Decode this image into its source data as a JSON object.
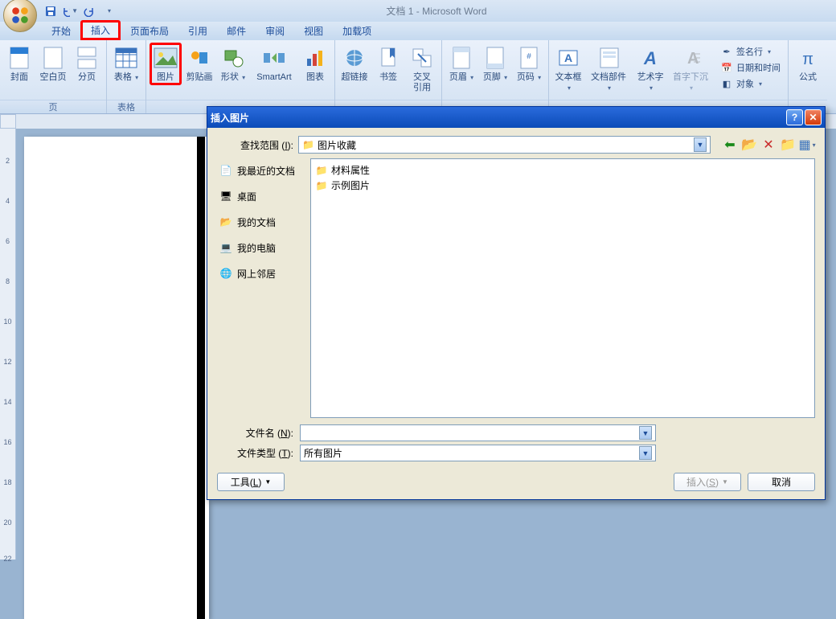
{
  "title": "文档 1 - Microsoft Word",
  "qat": {
    "save": "save",
    "undo": "undo",
    "redo": "redo"
  },
  "tabs": {
    "home": "开始",
    "insert": "插入",
    "layout": "页面布局",
    "references": "引用",
    "mail": "邮件",
    "review": "审阅",
    "view": "视图",
    "addins": "加载项"
  },
  "ribbon": {
    "cover": "封面",
    "blank": "空白页",
    "break": "分页",
    "pages_group": "页",
    "table": "表格",
    "tables_group": "表格",
    "picture": "图片",
    "clipart": "剪贴画",
    "shapes": "形状",
    "smartart": "SmartArt",
    "chart": "图表",
    "hyperlink": "超链接",
    "bookmark": "书签",
    "crossref": "交叉\n引用",
    "header": "页眉",
    "footer": "页脚",
    "pagenum": "页码",
    "textbox": "文本框",
    "quickparts": "文档部件",
    "wordart": "艺术字",
    "dropcap": "首字下沉",
    "signature": "签名行",
    "datetime": "日期和时间",
    "object": "对象",
    "equation": "公式"
  },
  "dialog": {
    "title": "插入图片",
    "lookin_label": "查找范围",
    "lookin_accel": "I",
    "lookin_value": "图片收藏",
    "places": {
      "recent": "我最近的文档",
      "desktop": "桌面",
      "mydocs": "我的文档",
      "mycomputer": "我的电脑",
      "network": "网上邻居"
    },
    "files": {
      "item1": "材料属性",
      "item2": "示例图片"
    },
    "filename_label": "文件名",
    "filename_accel": "N",
    "filename_value": "",
    "filetype_label": "文件类型",
    "filetype_accel": "T",
    "filetype_value": "所有图片",
    "tools": "工具",
    "tools_accel": "L",
    "insert": "插入",
    "insert_accel": "S",
    "cancel": "取消"
  },
  "ruler_ticks": [
    "2",
    "4",
    "6",
    "8",
    "10",
    "12",
    "14",
    "16",
    "18",
    "20",
    "22"
  ]
}
